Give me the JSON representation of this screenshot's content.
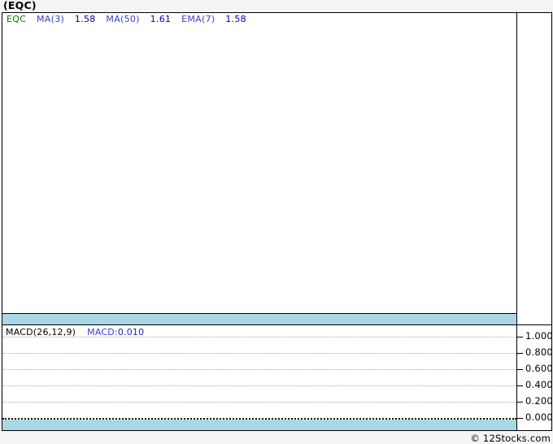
{
  "page": {
    "title": "(EQC)",
    "copyright": "© 12Stocks.com",
    "background_color": "#f4f4f4"
  },
  "colors": {
    "panel_background": "#ffffff",
    "border": "#000000",
    "highlight_band_blue": "#a9d7e5",
    "gridline_gray": "#adadad",
    "zero_line_black": "#111111",
    "ticker_green": "#007700",
    "indicator_label_blue": "#3a3ad6",
    "indicator_value_navy": "#0000a0"
  },
  "main_panel": {
    "legend": {
      "ticker": "EQC",
      "indicators": [
        {
          "label": "MA(3)",
          "value": "1.58"
        },
        {
          "label": "MA(50)",
          "value": "1.61"
        },
        {
          "label": "EMA(7)",
          "value": "1.58"
        }
      ]
    }
  },
  "macd_panel": {
    "title": "MACD(26,12,9)",
    "reading_label": "MACD:",
    "reading_value": "0.010",
    "axis_labels": [
      "1.000",
      "0.800",
      "0.600",
      "0.400",
      "0.200",
      "0.000"
    ]
  },
  "chart_data": [
    {
      "type": "line",
      "title": "(EQC) price panel",
      "series": [
        {
          "name": "EQC"
        },
        {
          "name": "MA(3)",
          "last_value": 1.58
        },
        {
          "name": "MA(50)",
          "last_value": 1.61
        },
        {
          "name": "EMA(7)",
          "last_value": 1.58
        }
      ],
      "plot_area_content": "blank",
      "bottom_band_color": "#a9d7e5"
    },
    {
      "type": "line",
      "title": "MACD(26,12,9)",
      "series": [
        {
          "name": "MACD",
          "last_value": 0.01
        }
      ],
      "ylim": [
        0.0,
        1.0
      ],
      "yticks": [
        1.0,
        0.8,
        0.6,
        0.4,
        0.2,
        0.0
      ],
      "grid": true,
      "zero_line": 0.0,
      "legend_position": "top-left",
      "bottom_band_color": "#a9d7e5"
    }
  ]
}
